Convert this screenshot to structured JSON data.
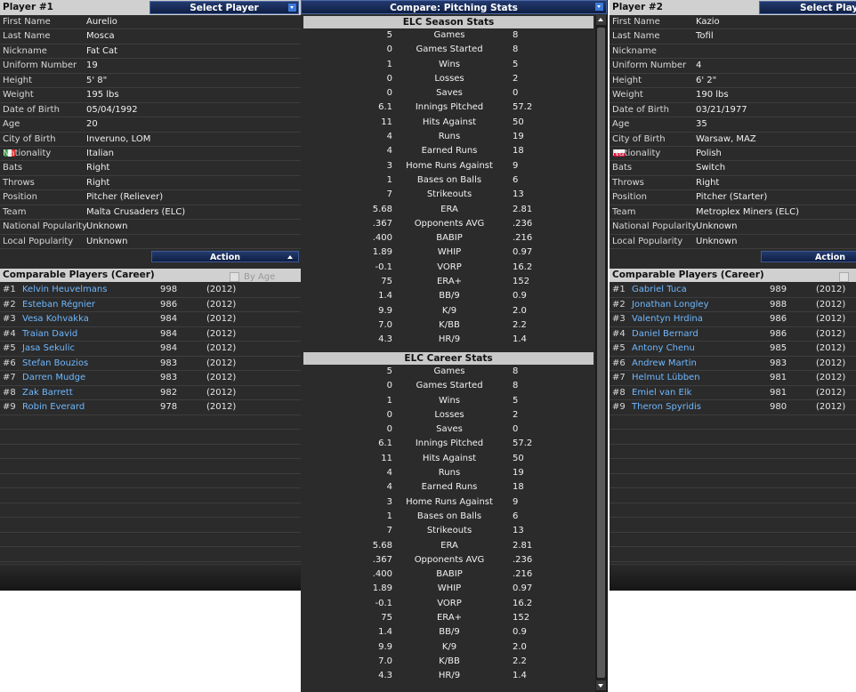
{
  "left": {
    "title": "Player #1",
    "select_label": "Select Player",
    "fields": [
      {
        "label": "First Name",
        "value": "Aurelio"
      },
      {
        "label": "Last Name",
        "value": "Mosca"
      },
      {
        "label": "Nickname",
        "value": "Fat Cat"
      },
      {
        "label": "Uniform Number",
        "value": "19"
      },
      {
        "label": "Height",
        "value": "5' 8\""
      },
      {
        "label": "Weight",
        "value": "195 lbs"
      },
      {
        "label": "Date of Birth",
        "value": "05/04/1992"
      },
      {
        "label": "Age",
        "value": "20"
      },
      {
        "label": "City of Birth",
        "value": "Inveruno, LOM"
      },
      {
        "label": "Nationality",
        "value": "Italian"
      },
      {
        "label": "Bats",
        "value": "Right"
      },
      {
        "label": "Throws",
        "value": "Right"
      },
      {
        "label": "Position",
        "value": "Pitcher (Reliever)"
      },
      {
        "label": "Team",
        "value": "Malta Crusaders (ELC)"
      },
      {
        "label": "National Popularity",
        "value": "Unknown"
      },
      {
        "label": "Local Popularity",
        "value": "Unknown"
      }
    ],
    "action_label": "Action",
    "comparable_title": "Comparable Players (Career)",
    "by_age_label": "By Age",
    "comparables": [
      {
        "rank": "#1",
        "name": "Kelvin Heuvelmans",
        "score": "998",
        "year": "(2012)"
      },
      {
        "rank": "#2",
        "name": "Esteban Régnier",
        "score": "986",
        "year": "(2012)"
      },
      {
        "rank": "#3",
        "name": "Vesa Kohvakka",
        "score": "984",
        "year": "(2012)"
      },
      {
        "rank": "#4",
        "name": "Traian David",
        "score": "984",
        "year": "(2012)"
      },
      {
        "rank": "#5",
        "name": "Jasa Sekulic",
        "score": "984",
        "year": "(2012)"
      },
      {
        "rank": "#6",
        "name": "Stefan Bouzios",
        "score": "983",
        "year": "(2012)"
      },
      {
        "rank": "#7",
        "name": "Darren Mudge",
        "score": "983",
        "year": "(2012)"
      },
      {
        "rank": "#8",
        "name": "Zak Barrett",
        "score": "982",
        "year": "(2012)"
      },
      {
        "rank": "#9",
        "name": "Robin Everard",
        "score": "978",
        "year": "(2012)"
      }
    ]
  },
  "right": {
    "title": "Player #2",
    "select_label": "Select Player",
    "fields": [
      {
        "label": "First Name",
        "value": "Kazio"
      },
      {
        "label": "Last Name",
        "value": "Tofil"
      },
      {
        "label": "Nickname",
        "value": ""
      },
      {
        "label": "Uniform Number",
        "value": "4"
      },
      {
        "label": "Height",
        "value": "6' 2\""
      },
      {
        "label": "Weight",
        "value": "190 lbs"
      },
      {
        "label": "Date of Birth",
        "value": "03/21/1977"
      },
      {
        "label": "Age",
        "value": "35"
      },
      {
        "label": "City of Birth",
        "value": "Warsaw, MAZ"
      },
      {
        "label": "Nationality",
        "value": "Polish"
      },
      {
        "label": "Bats",
        "value": "Switch"
      },
      {
        "label": "Throws",
        "value": "Right"
      },
      {
        "label": "Position",
        "value": "Pitcher (Starter)"
      },
      {
        "label": "Team",
        "value": "Metroplex Miners (ELC)"
      },
      {
        "label": "National Popularity",
        "value": "Unknown"
      },
      {
        "label": "Local Popularity",
        "value": "Unknown"
      }
    ],
    "action_label": "Action",
    "comparable_title": "Comparable Players (Career)",
    "comparables": [
      {
        "rank": "#1",
        "name": "Gabriel Tuca",
        "score": "989",
        "year": "(2012)"
      },
      {
        "rank": "#2",
        "name": "Jonathan Longley",
        "score": "988",
        "year": "(2012)"
      },
      {
        "rank": "#3",
        "name": "Valentyn Hrdina",
        "score": "986",
        "year": "(2012)"
      },
      {
        "rank": "#4",
        "name": "Daniel Bernard",
        "score": "986",
        "year": "(2012)"
      },
      {
        "rank": "#5",
        "name": "Antony Chenu",
        "score": "985",
        "year": "(2012)"
      },
      {
        "rank": "#6",
        "name": "Andrew Martin",
        "score": "983",
        "year": "(2012)"
      },
      {
        "rank": "#7",
        "name": "Helmut Lübben",
        "score": "981",
        "year": "(2012)"
      },
      {
        "rank": "#8",
        "name": "Emiel van Elk",
        "score": "981",
        "year": "(2012)"
      },
      {
        "rank": "#9",
        "name": "Theron Spyridis",
        "score": "980",
        "year": "(2012)"
      }
    ]
  },
  "compare": {
    "title": "Compare: Pitching Stats",
    "sections": [
      {
        "title": "ELC Season Stats",
        "rows": [
          {
            "left": "5",
            "stat": "Games",
            "right": "8"
          },
          {
            "left": "0",
            "stat": "Games Started",
            "right": "8"
          },
          {
            "left": "1",
            "stat": "Wins",
            "right": "5"
          },
          {
            "left": "0",
            "stat": "Losses",
            "right": "2"
          },
          {
            "left": "0",
            "stat": "Saves",
            "right": "0"
          },
          {
            "left": "6.1",
            "stat": "Innings Pitched",
            "right": "57.2"
          },
          {
            "left": "11",
            "stat": "Hits Against",
            "right": "50"
          },
          {
            "left": "4",
            "stat": "Runs",
            "right": "19"
          },
          {
            "left": "4",
            "stat": "Earned Runs",
            "right": "18"
          },
          {
            "left": "3",
            "stat": "Home Runs Against",
            "right": "9"
          },
          {
            "left": "1",
            "stat": "Bases on Balls",
            "right": "6"
          },
          {
            "left": "7",
            "stat": "Strikeouts",
            "right": "13"
          },
          {
            "left": "5.68",
            "stat": "ERA",
            "right": "2.81"
          },
          {
            "left": ".367",
            "stat": "Opponents AVG",
            "right": ".236"
          },
          {
            "left": ".400",
            "stat": "BABIP",
            "right": ".216"
          },
          {
            "left": "1.89",
            "stat": "WHIP",
            "right": "0.97"
          },
          {
            "left": "-0.1",
            "stat": "VORP",
            "right": "16.2"
          },
          {
            "left": "75",
            "stat": "ERA+",
            "right": "152"
          },
          {
            "left": "1.4",
            "stat": "BB/9",
            "right": "0.9"
          },
          {
            "left": "9.9",
            "stat": "K/9",
            "right": "2.0"
          },
          {
            "left": "7.0",
            "stat": "K/BB",
            "right": "2.2"
          },
          {
            "left": "4.3",
            "stat": "HR/9",
            "right": "1.4"
          }
        ]
      },
      {
        "title": "ELC Career Stats",
        "rows": [
          {
            "left": "5",
            "stat": "Games",
            "right": "8"
          },
          {
            "left": "0",
            "stat": "Games Started",
            "right": "8"
          },
          {
            "left": "1",
            "stat": "Wins",
            "right": "5"
          },
          {
            "left": "0",
            "stat": "Losses",
            "right": "2"
          },
          {
            "left": "0",
            "stat": "Saves",
            "right": "0"
          },
          {
            "left": "6.1",
            "stat": "Innings Pitched",
            "right": "57.2"
          },
          {
            "left": "11",
            "stat": "Hits Against",
            "right": "50"
          },
          {
            "left": "4",
            "stat": "Runs",
            "right": "19"
          },
          {
            "left": "4",
            "stat": "Earned Runs",
            "right": "18"
          },
          {
            "left": "3",
            "stat": "Home Runs Against",
            "right": "9"
          },
          {
            "left": "1",
            "stat": "Bases on Balls",
            "right": "6"
          },
          {
            "left": "7",
            "stat": "Strikeouts",
            "right": "13"
          },
          {
            "left": "5.68",
            "stat": "ERA",
            "right": "2.81"
          },
          {
            "left": ".367",
            "stat": "Opponents AVG",
            "right": ".236"
          },
          {
            "left": ".400",
            "stat": "BABIP",
            "right": ".216"
          },
          {
            "left": "1.89",
            "stat": "WHIP",
            "right": "0.97"
          },
          {
            "left": "-0.1",
            "stat": "VORP",
            "right": "16.2"
          },
          {
            "left": "75",
            "stat": "ERA+",
            "right": "152"
          },
          {
            "left": "1.4",
            "stat": "BB/9",
            "right": "0.9"
          },
          {
            "left": "9.9",
            "stat": "K/9",
            "right": "2.0"
          },
          {
            "left": "7.0",
            "stat": "K/BB",
            "right": "2.2"
          },
          {
            "left": "4.3",
            "stat": "HR/9",
            "right": "1.4"
          }
        ]
      }
    ]
  },
  "colors": {
    "link": "#6fb8ff",
    "button_blue": "#0f1f44",
    "panel_bg": "#2b2b2b"
  },
  "flags": {
    "left": "italy-flag-icon",
    "right": "poland-flag-icon"
  }
}
